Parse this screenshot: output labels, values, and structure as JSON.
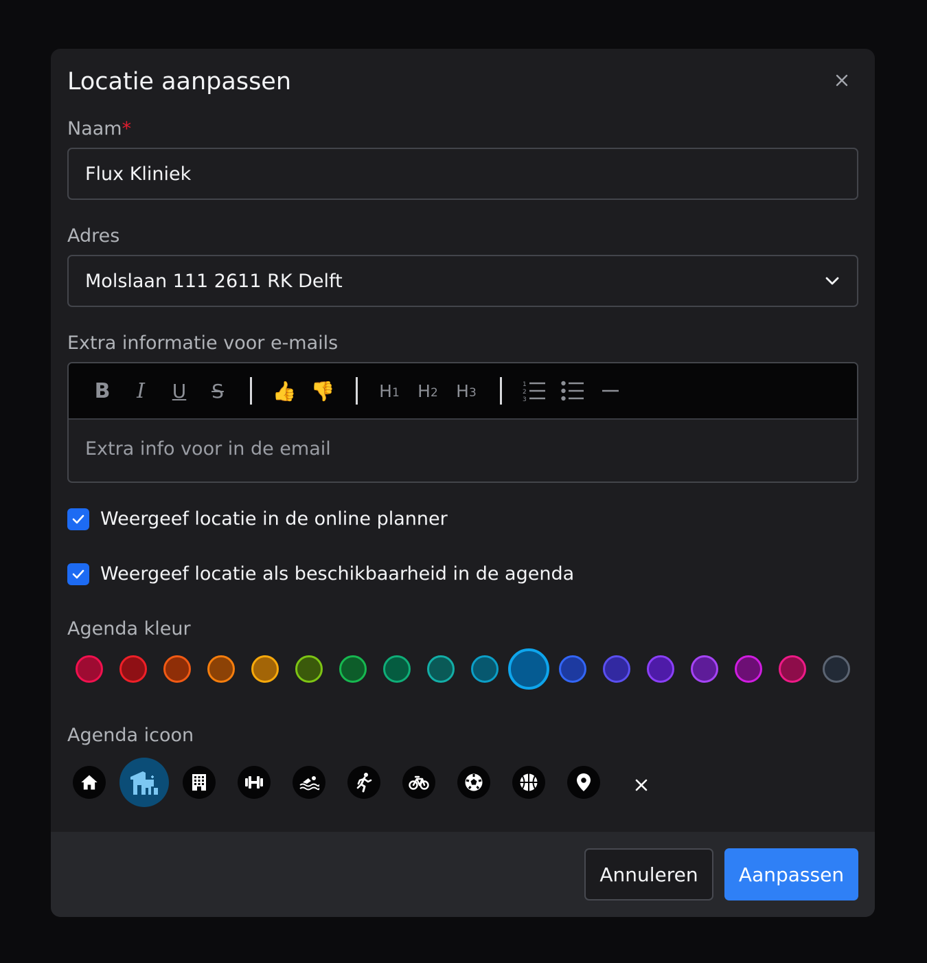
{
  "modal": {
    "title": "Locatie aanpassen",
    "close_icon": "close-icon"
  },
  "name_field": {
    "label": "Naam",
    "required_mark": "*",
    "value": "Flux Kliniek"
  },
  "address_field": {
    "label": "Adres",
    "value": "Molslaan 111 2611 RK Delft",
    "icon": "chevron-down-icon"
  },
  "email_info": {
    "label": "Extra informatie voor e-mails",
    "placeholder": "Extra info voor in de email",
    "toolbar": {
      "bold": "B",
      "italic": "I",
      "underline": "U",
      "strike": "S",
      "thumbs_up": "👍",
      "thumbs_down": "👎",
      "h1": "H",
      "h1_sub": "1",
      "h2": "H",
      "h2_sub": "2",
      "h3": "H",
      "h3_sub": "3",
      "ordered_list_icon": "ordered-list-icon",
      "bullet_list_icon": "bullet-list-icon",
      "horizontal_rule_icon": "horizontal-rule-icon"
    }
  },
  "checkboxes": [
    {
      "label": "Weergeef locatie in de online planner",
      "checked": true
    },
    {
      "label": "Weergeef locatie als beschikbaarheid in de agenda",
      "checked": true
    }
  ],
  "color_picker": {
    "label": "Agenda kleur",
    "selected_index": 10,
    "colors": [
      {
        "fill": "#9e0b32",
        "ring": "#f0114e"
      },
      {
        "fill": "#8f1015",
        "ring": "#ef2028"
      },
      {
        "fill": "#8f2e07",
        "ring": "#f15a14"
      },
      {
        "fill": "#8c4206",
        "ring": "#f57e0d"
      },
      {
        "fill": "#a36507",
        "ring": "#f7a90b"
      },
      {
        "fill": "#3b5a0b",
        "ring": "#7dc414"
      },
      {
        "fill": "#0d5d2a",
        "ring": "#17b850"
      },
      {
        "fill": "#055c40",
        "ring": "#0fae78"
      },
      {
        "fill": "#0a5a57",
        "ring": "#13aea7"
      },
      {
        "fill": "#07586f",
        "ring": "#0c9fc7"
      },
      {
        "fill": "#055b92",
        "ring": "#0ea5ec"
      },
      {
        "fill": "#1d3aa0",
        "ring": "#3366f6"
      },
      {
        "fill": "#3229a1",
        "ring": "#5a4ff0"
      },
      {
        "fill": "#4e1ba8",
        "ring": "#8a3ff7"
      },
      {
        "fill": "#5e1c99",
        "ring": "#a544f5"
      },
      {
        "fill": "#6d0f75",
        "ring": "#cf1de0"
      },
      {
        "fill": "#8e0d4a",
        "ring": "#ee1a87"
      },
      {
        "fill": "#222a36",
        "ring": "#5b6472"
      }
    ]
  },
  "icon_picker": {
    "label": "Agenda icoon",
    "selected_index": 1,
    "icons": [
      "house-icon",
      "clinic-icon",
      "building-icon",
      "dumbbell-icon",
      "swimming-icon",
      "running-icon",
      "bicycle-icon",
      "soccer-ball-icon",
      "basketball-icon",
      "location-pin-icon"
    ],
    "clear_icon": "close-icon"
  },
  "footer": {
    "cancel": "Annuleren",
    "submit": "Aanpassen"
  },
  "colors": {
    "primary": "#2f80f6",
    "checkbox": "#1d6bf3",
    "selected_icon_bg": "#0b4d77",
    "selected_icon_fg": "#7cc7f2",
    "required": "#e11d2f"
  }
}
